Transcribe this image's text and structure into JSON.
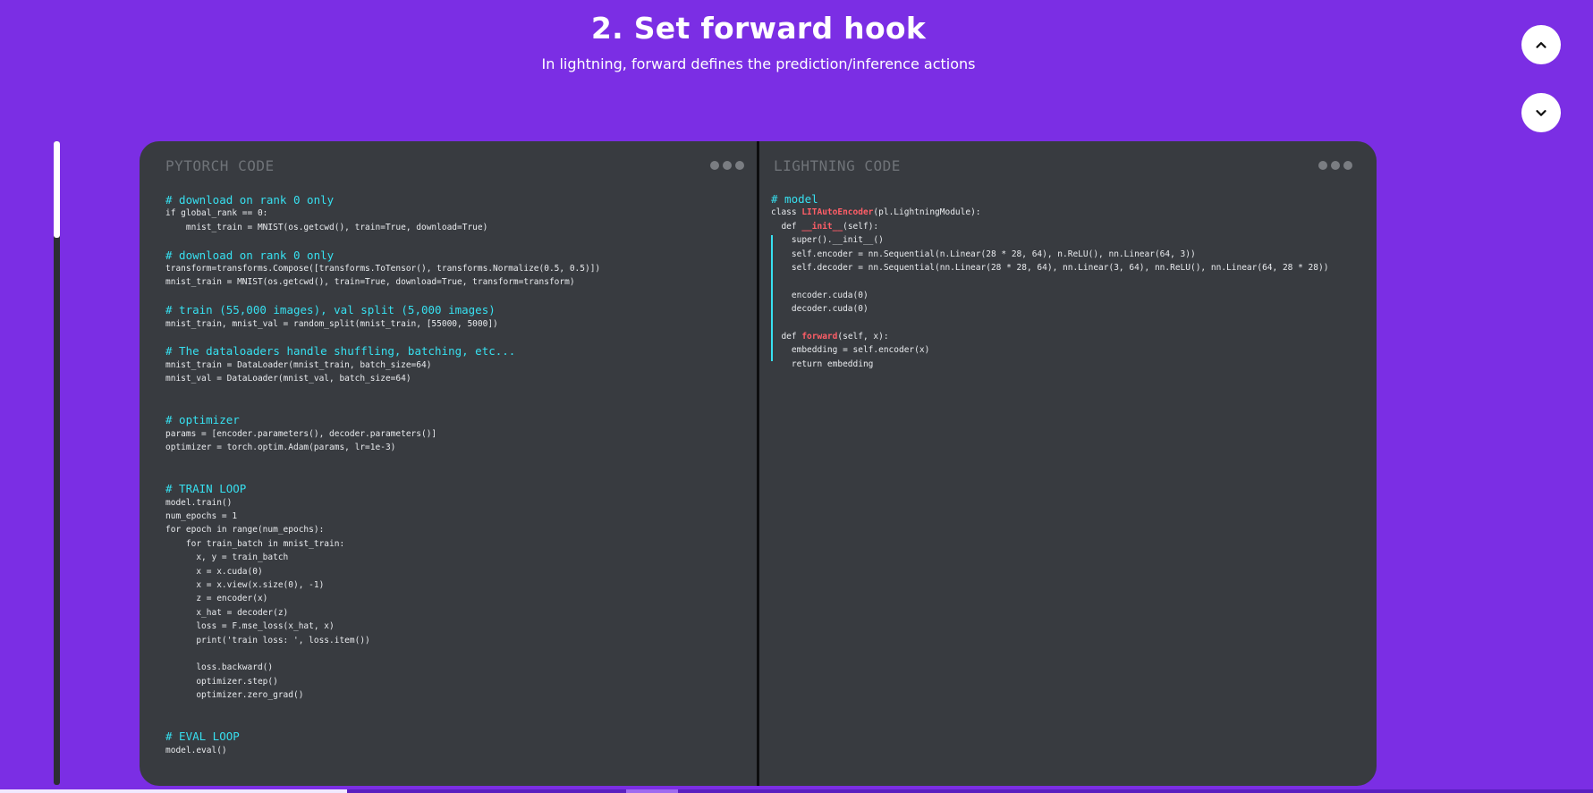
{
  "header": {
    "title": "2. Set forward hook",
    "subtitle": "In lightning, forward defines the prediction/inference actions"
  },
  "nav": {
    "up_icon": "chevron-up-icon",
    "down_icon": "chevron-down-icon"
  },
  "left_pane": {
    "title": "PYTORCH CODE",
    "lines": [
      {
        "t": "# download on rank 0 only",
        "c": true
      },
      {
        "t": "if global_rank == 0:"
      },
      {
        "t": "    mnist_train = MNIST(os.getcwd(), train=True, download=True)"
      },
      {
        "t": ""
      },
      {
        "t": "# download on rank 0 only",
        "c": true
      },
      {
        "t": "transform=transforms.Compose([transforms.ToTensor(), transforms.Normalize(0.5, 0.5)])"
      },
      {
        "t": "mnist_train = MNIST(os.getcwd(), train=True, download=True, transform=transform)"
      },
      {
        "t": ""
      },
      {
        "t": "# train (55,000 images), val split (5,000 images)",
        "c": true
      },
      {
        "t": "mnist_train, mnist_val = random_split(mnist_train, [55000, 5000])"
      },
      {
        "t": ""
      },
      {
        "t": "# The dataloaders handle shuffling, batching, etc...",
        "c": true
      },
      {
        "t": "mnist_train = DataLoader(mnist_train, batch_size=64)"
      },
      {
        "t": "mnist_val = DataLoader(mnist_val, batch_size=64)"
      },
      {
        "t": ""
      },
      {
        "t": ""
      },
      {
        "t": "# optimizer",
        "c": true
      },
      {
        "t": "params = [encoder.parameters(), decoder.parameters()]"
      },
      {
        "t": "optimizer = torch.optim.Adam(params, lr=1e-3)"
      },
      {
        "t": ""
      },
      {
        "t": ""
      },
      {
        "t": "# TRAIN LOOP",
        "c": true
      },
      {
        "t": "model.train()"
      },
      {
        "t": "num_epochs = 1"
      },
      {
        "t": "for epoch in range(num_epochs):"
      },
      {
        "t": "    for train_batch in mnist_train:"
      },
      {
        "t": "      x, y = train_batch"
      },
      {
        "t": "      x = x.cuda(0)"
      },
      {
        "t": "      x = x.view(x.size(0), -1)"
      },
      {
        "t": "      z = encoder(x)"
      },
      {
        "t": "      x_hat = decoder(z)"
      },
      {
        "t": "      loss = F.mse_loss(x_hat, x)"
      },
      {
        "t": "      print('train loss: ', loss.item())"
      },
      {
        "t": ""
      },
      {
        "t": "      loss.backward()"
      },
      {
        "t": "      optimizer.step()"
      },
      {
        "t": "      optimizer.zero_grad()"
      },
      {
        "t": ""
      },
      {
        "t": ""
      },
      {
        "t": "# EVAL LOOP",
        "c": true
      },
      {
        "t": "model.eval()"
      }
    ]
  },
  "right_pane": {
    "title": "LIGHTNING CODE",
    "lines": [
      {
        "parts": [
          {
            "t": "# model"
          }
        ],
        "c": true
      },
      {
        "parts": [
          {
            "t": "class "
          },
          {
            "t": "LITAutoEncoder",
            "h": true
          },
          {
            "t": "(pl.LightningModule):"
          }
        ]
      },
      {
        "parts": [
          {
            "t": "  def "
          },
          {
            "t": "__init__",
            "h": true
          },
          {
            "t": "(self):"
          }
        ]
      },
      {
        "parts": [
          {
            "t": "    super().__init__()"
          }
        ]
      },
      {
        "parts": [
          {
            "t": "    self.encoder = nn.Sequential(n.Linear(28 * 28, 64), n.ReLU(), nn.Linear(64, 3))"
          }
        ]
      },
      {
        "parts": [
          {
            "t": "    self.decoder = nn.Sequential(nn.Linear(28 * 28, 64), nn.Linear(3, 64), nn.ReLU(), nn.Linear(64, 28 * 28))"
          }
        ]
      },
      {
        "parts": [
          {
            "t": ""
          }
        ]
      },
      {
        "parts": [
          {
            "t": "    encoder.cuda(0)"
          }
        ]
      },
      {
        "parts": [
          {
            "t": "    decoder.cuda(0)"
          }
        ]
      },
      {
        "parts": [
          {
            "t": ""
          }
        ]
      },
      {
        "parts": [
          {
            "t": "  def "
          },
          {
            "t": "forward",
            "h": true
          },
          {
            "t": "(self, x):"
          }
        ]
      },
      {
        "parts": [
          {
            "t": "    embedding = self.encoder(x)"
          }
        ]
      },
      {
        "parts": [
          {
            "t": "    return embedding"
          }
        ]
      }
    ]
  }
}
